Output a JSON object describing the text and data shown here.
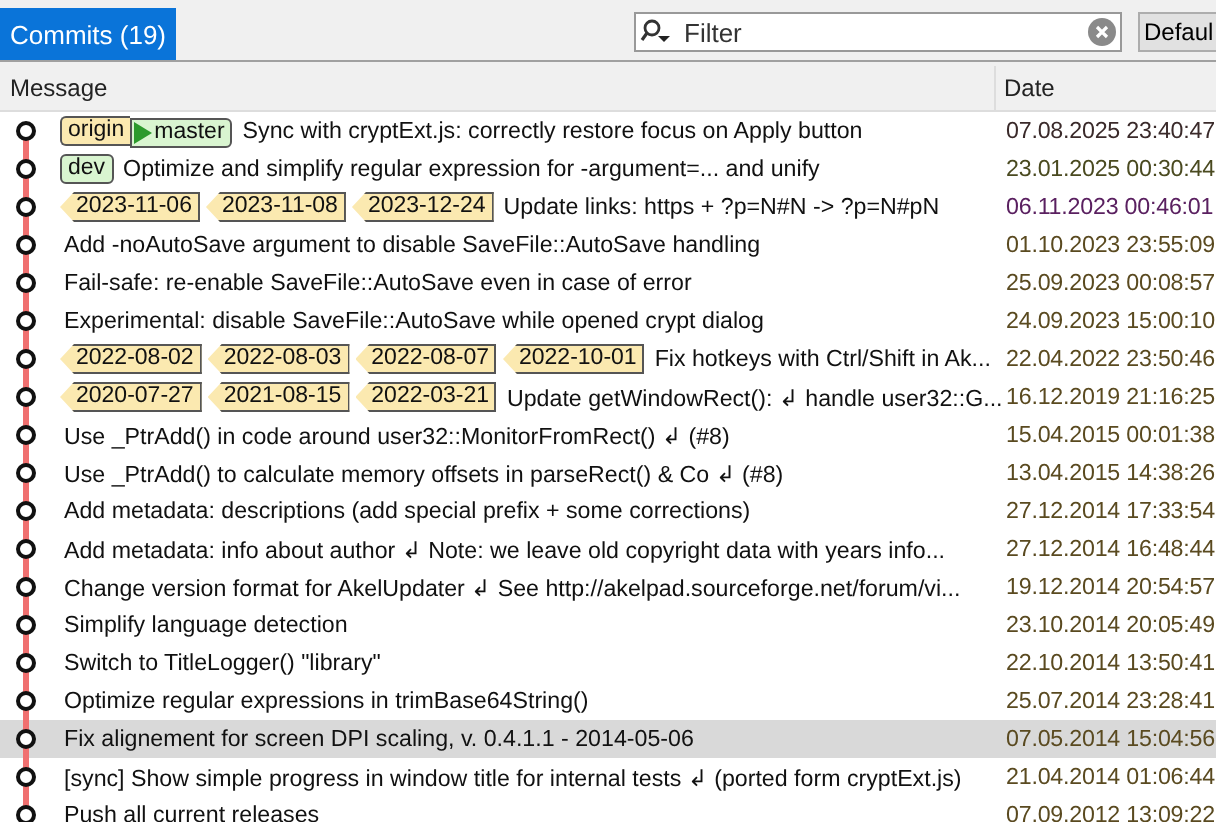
{
  "tabs": [
    {
      "label": "Commits (19)",
      "selected": true
    }
  ],
  "filter": {
    "placeholder": "Filter"
  },
  "view_button": {
    "label": "Defaul"
  },
  "table": {
    "columns": [
      "Message",
      "Date"
    ],
    "rows": [
      {
        "refs": [
          {
            "kind": "remote",
            "label": "origin"
          },
          {
            "kind": "head",
            "label": "master"
          }
        ],
        "message": "Sync with cryptExt.js: correctly restore focus on Apply button",
        "date": "07.08.2025 23:40:47",
        "color": "#3a2a2a",
        "selected": false
      },
      {
        "refs": [
          {
            "kind": "branch",
            "label": "dev"
          }
        ],
        "message": "Optimize and simplify regular expression for -argument=... and unify",
        "date": "23.01.2025 00:30:44",
        "color": "#4a4a20",
        "selected": false
      },
      {
        "refs": [
          {
            "kind": "tag",
            "label": "2023-11-06"
          },
          {
            "kind": "tag",
            "label": "2023-11-08"
          },
          {
            "kind": "tag",
            "label": "2023-12-24"
          }
        ],
        "message": "Update links: https + ?p=N#N -> ?p=N#pN",
        "date": "06.11.2023 00:46:01",
        "color": "#5a2060",
        "selected": false
      },
      {
        "refs": [],
        "message": "Add -noAutoSave argument to disable SaveFile::AutoSave handling",
        "date": "01.10.2023 23:55:09",
        "color": "#5a4a20",
        "selected": false
      },
      {
        "refs": [],
        "message": "Fail-safe: re-enable SaveFile::AutoSave even in case of error",
        "date": "25.09.2023 00:08:57",
        "color": "#5a4a20",
        "selected": false
      },
      {
        "refs": [],
        "message": "Experimental: disable SaveFile::AutoSave while opened crypt dialog",
        "date": "24.09.2023 15:00:10",
        "color": "#5a4a20",
        "selected": false
      },
      {
        "refs": [
          {
            "kind": "tag",
            "label": "2022-08-02"
          },
          {
            "kind": "tag",
            "label": "2022-08-03"
          },
          {
            "kind": "tag",
            "label": "2022-08-07"
          },
          {
            "kind": "tag",
            "label": "2022-10-01"
          }
        ],
        "message": "Fix hotkeys with Ctrl/Shift in Ak...",
        "date": "22.04.2022 23:50:46",
        "color": "#5a4a20",
        "selected": false
      },
      {
        "refs": [
          {
            "kind": "tag",
            "label": "2020-07-27"
          },
          {
            "kind": "tag",
            "label": "2021-08-15"
          },
          {
            "kind": "tag",
            "label": "2022-03-21"
          }
        ],
        "message": "Update getWindowRect(): ↲ handle user32::G...",
        "date": "16.12.2019 21:16:25",
        "color": "#5a4a20",
        "selected": false
      },
      {
        "refs": [],
        "message": "Use _PtrAdd() in code around user32::MonitorFromRect() ↲ (#8)",
        "date": "15.04.2015 00:01:38",
        "color": "#5a4a20",
        "selected": false
      },
      {
        "refs": [],
        "message": "Use _PtrAdd() to calculate memory offsets in parseRect() & Co ↲ (#8)",
        "date": "13.04.2015 14:38:26",
        "color": "#5a4a20",
        "selected": false
      },
      {
        "refs": [],
        "message": "Add metadata: descriptions (add special prefix + some corrections)",
        "date": "27.12.2014 17:33:54",
        "color": "#5a4a20",
        "selected": false
      },
      {
        "refs": [],
        "message": "Add metadata: info about author ↲ Note: we leave old copyright data with years info...",
        "date": "27.12.2014 16:48:44",
        "color": "#5a4a20",
        "selected": false
      },
      {
        "refs": [],
        "message": "Change version format for AkelUpdater ↲ See http://akelpad.sourceforge.net/forum/vi...",
        "date": "19.12.2014 20:54:57",
        "color": "#5a4a20",
        "selected": false
      },
      {
        "refs": [],
        "message": "Simplify language detection",
        "date": "23.10.2014 20:05:49",
        "color": "#5a4a20",
        "selected": false
      },
      {
        "refs": [],
        "message": "Switch to TitleLogger() \"library\"",
        "date": "22.10.2014 13:50:41",
        "color": "#5a4a20",
        "selected": false
      },
      {
        "refs": [],
        "message": "Optimize regular expressions in trimBase64String()",
        "date": "25.07.2014 23:28:41",
        "color": "#5a4a20",
        "selected": false
      },
      {
        "refs": [],
        "message": "Fix alignement for screen DPI scaling, v. 0.4.1.1 - 2014-05-06",
        "date": "07.05.2014 15:04:56",
        "color": "#5a4a20",
        "selected": true
      },
      {
        "refs": [],
        "message": "[sync] Show simple progress in window title for internal tests ↲ (ported form cryptExt.js)",
        "date": "21.04.2014 01:06:44",
        "color": "#5a4a20",
        "selected": false
      },
      {
        "refs": [],
        "message": "Push all current releases",
        "date": "07.09.2012 13:09:22",
        "color": "#5a4a20",
        "selected": false
      }
    ]
  }
}
